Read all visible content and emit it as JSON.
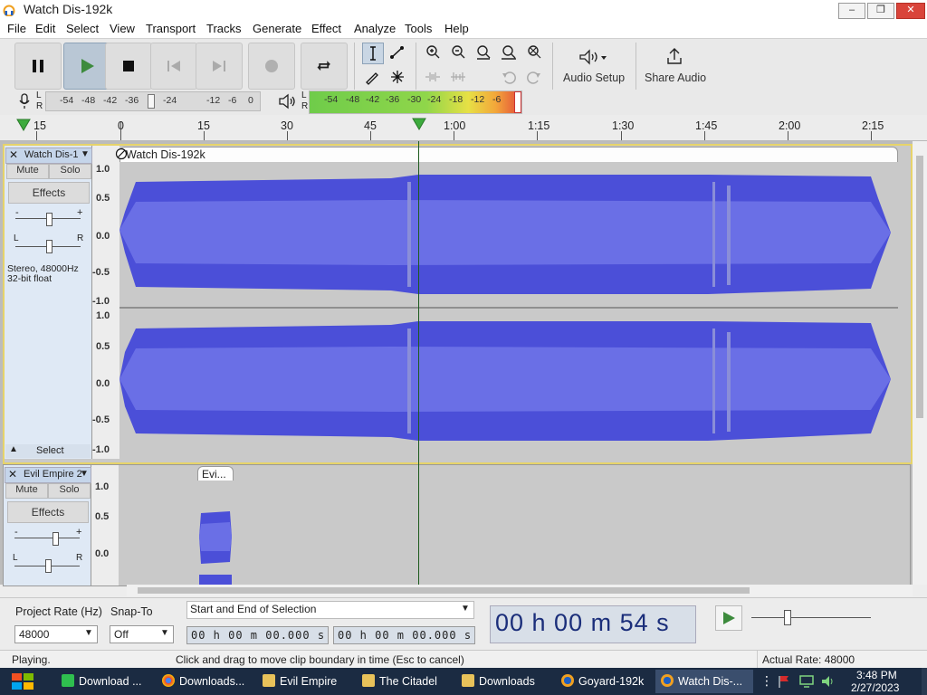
{
  "window": {
    "title": "Watch Dis-192k"
  },
  "menu": [
    "File",
    "Edit",
    "Select",
    "View",
    "Transport",
    "Tracks",
    "Generate",
    "Effect",
    "Analyze",
    "Tools",
    "Help"
  ],
  "toolbar": {
    "audio_setup_label": "Audio Setup",
    "share_audio_label": "Share Audio",
    "record_meter_labels": [
      "L",
      "R"
    ],
    "meter_ticks": [
      "-54",
      "-48",
      "-42",
      "-36",
      "-24",
      "-12",
      "-6",
      "0"
    ],
    "play_meter_ticks": [
      "-54",
      "-48",
      "-42",
      "-36",
      "-30",
      "-24",
      "-18",
      "-12",
      "-6"
    ],
    "play_meter_labels": [
      "L",
      "R"
    ]
  },
  "ruler": {
    "labels": [
      "15",
      "0",
      "15",
      "30",
      "45",
      "1:00",
      "1:15",
      "1:30",
      "1:45",
      "2:00",
      "2:15"
    ]
  },
  "tracks": [
    {
      "name": "Watch Dis-1",
      "clip_name": "Watch Dis-192k",
      "mute": "Mute",
      "solo": "Solo",
      "effects": "Effects",
      "gain_min": "-",
      "gain_max": "+",
      "pan_left": "L",
      "pan_right": "R",
      "info_line1": "Stereo, 48000Hz",
      "info_line2": "32-bit float",
      "select": "Select",
      "scale": [
        "1.0",
        "0.5",
        "0.0",
        "-0.5",
        "-1.0"
      ]
    },
    {
      "name": "Evil Empire 2",
      "clip_name": "Evi...",
      "mute": "Mute",
      "solo": "Solo",
      "effects": "Effects",
      "gain_min": "-",
      "gain_max": "+",
      "pan_left": "L",
      "pan_right": "R",
      "scale": [
        "1.0",
        "0.5",
        "0.0"
      ]
    }
  ],
  "selection": {
    "project_rate_label": "Project Rate (Hz)",
    "project_rate_value": "48000",
    "snap_to_label": "Snap-To",
    "snap_to_value": "Off",
    "mode": "Start and End of Selection",
    "start": "00 h 00 m 00.000 s",
    "end": "00 h 00 m 00.000 s",
    "big_time": "00 h 00 m 54 s"
  },
  "status": {
    "state": "Playing.",
    "hint": "Click and drag to move clip boundary in time (Esc to cancel)",
    "rate": "Actual Rate: 48000"
  },
  "taskbar": {
    "items": [
      "Download ...",
      "Downloads...",
      "Evil Empire",
      "The Citadel",
      "Downloads",
      "Goyard-192k",
      "Watch Dis-..."
    ],
    "time": "3:48 PM",
    "date": "2/27/2023"
  },
  "colors": {
    "wave": "#4b4fd8",
    "wave_light": "#6a6fe6",
    "track_bg": "#c9c9c9",
    "ctrl_bg": "#dfe9f5",
    "play_green": "#4caf50"
  }
}
